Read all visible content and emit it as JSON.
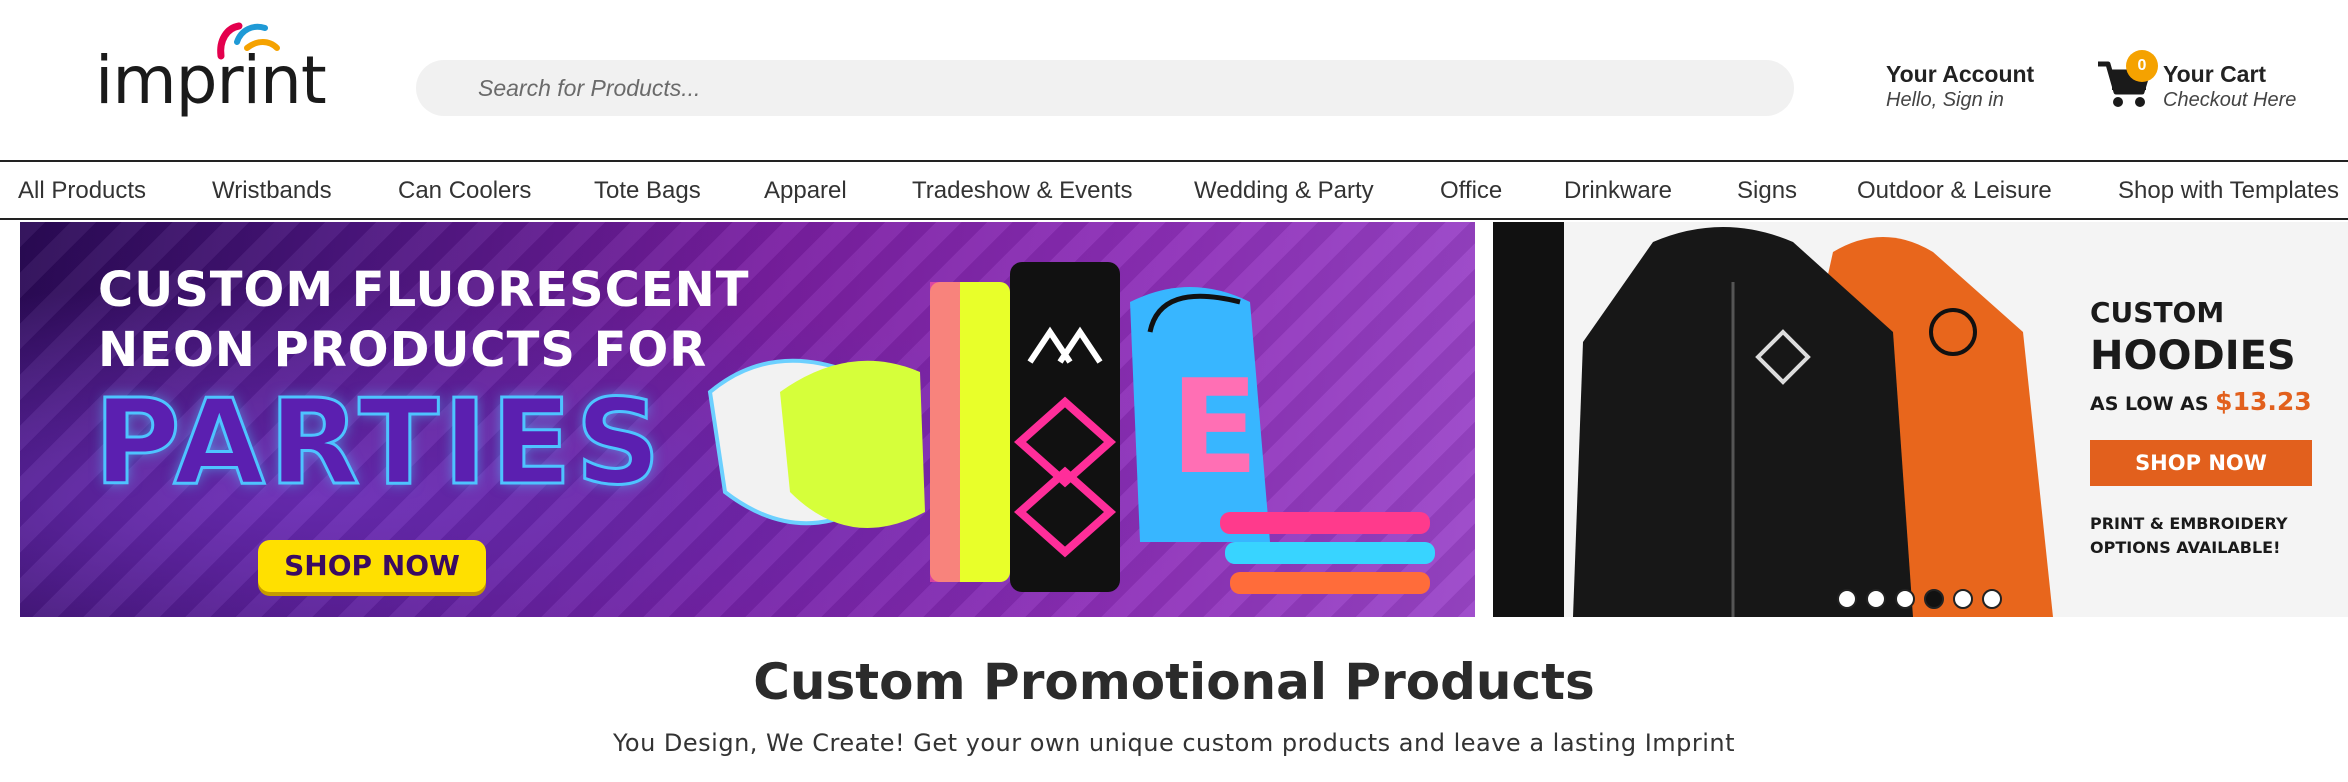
{
  "logo": {
    "text": "imprint",
    "colors": [
      "#e4004d",
      "#1f9ad6",
      "#f5a200"
    ]
  },
  "search": {
    "placeholder": "Search for Products..."
  },
  "account": {
    "title": "Your Account",
    "subtitle": "Hello, Sign in"
  },
  "cart": {
    "title": "Your Cart",
    "subtitle": "Checkout Here",
    "count": "0"
  },
  "nav": {
    "items": [
      {
        "label": "All Products"
      },
      {
        "label": "Wristbands"
      },
      {
        "label": "Can Coolers"
      },
      {
        "label": "Tote Bags"
      },
      {
        "label": "Apparel"
      },
      {
        "label": "Tradeshow & Events"
      },
      {
        "label": "Wedding & Party"
      },
      {
        "label": "Office"
      },
      {
        "label": "Drinkware"
      },
      {
        "label": "Signs"
      },
      {
        "label": "Outdoor & Leisure"
      },
      {
        "label": "Shop with Templates"
      }
    ]
  },
  "hero_left": {
    "line1": "CUSTOM FLUORESCENT",
    "line2": "NEON PRODUCTS FOR",
    "line3": "PARTIES",
    "button": "SHOP NOW"
  },
  "hero_right": {
    "title1": "CUSTOM",
    "title2": "HOODIES",
    "price_prefix": "AS LOW AS ",
    "price": "$13.23",
    "button": "SHOP NOW",
    "note1": "PRINT & EMBROIDERY",
    "note2": "OPTIONS AVAILABLE!"
  },
  "carousel": {
    "dot_count": 6,
    "active_index": 3
  },
  "main": {
    "title": "Custom Promotional Products",
    "subtitle": "You Design, We Create! Get your own unique custom products and leave a lasting Imprint"
  },
  "colors": {
    "accent_orange": "#e2601d",
    "button_yellow": "#ffe000",
    "badge": "#f5a200"
  }
}
